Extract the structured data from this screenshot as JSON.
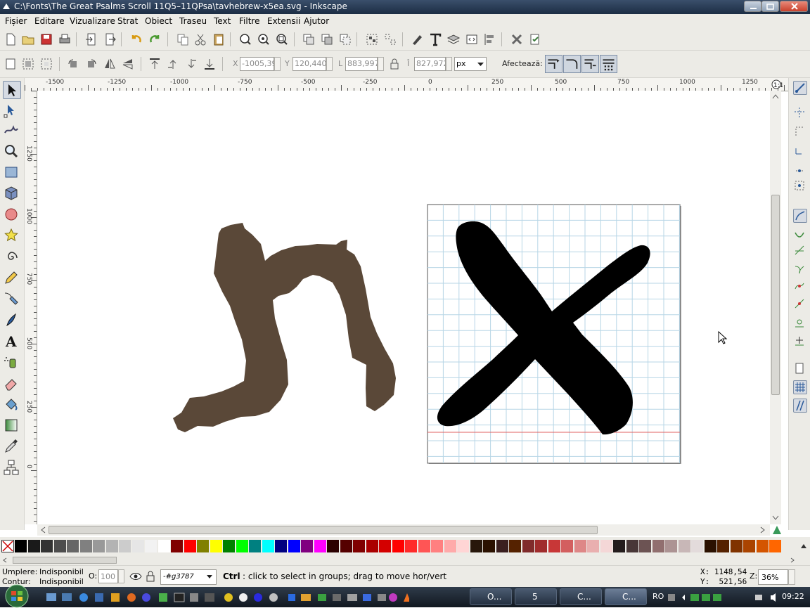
{
  "window": {
    "title": "C:\\Fonts\\The Great Psalms Scroll 11Q5–11QPsa\\tavhebrew-x5ea.svg - Inkscape"
  },
  "menu": [
    "Fișier",
    "Editare",
    "Vizualizare",
    "Strat",
    "Obiect",
    "Traseu",
    "Text",
    "Filtre",
    "Extensii",
    "Ajutor"
  ],
  "controls": {
    "x_label": "X",
    "x_value": "-1005,39",
    "y_label": "Y",
    "y_value": "120,440",
    "w_label": "L",
    "w_value": "883,997",
    "h_label": "Î",
    "h_value": "827,972",
    "unit": "px",
    "affect_label": "Afectează:"
  },
  "ruler": {
    "h_ticks": [
      "-1500",
      "-1250",
      "-1000",
      "-750",
      "-500",
      "-250",
      "0",
      "250",
      "500",
      "750",
      "1000",
      "1250"
    ],
    "v_ticks": [
      "1250",
      "1000",
      "750",
      "500",
      "250",
      "0"
    ]
  },
  "statusbar": {
    "fill_label": "Umplere:",
    "fill_value": "Indisponibil",
    "stroke_label": "Contur:",
    "stroke_value": "Indisponibil",
    "opacity_label": "O:",
    "opacity_value": "100",
    "layer_value": "-#g3787",
    "message_bold": "Ctrl",
    "message": ": click to select in groups; drag to move hor/vert",
    "cursor_x": "X: 1148,54",
    "cursor_y": "Y:  521,56",
    "zoom_label": "Z:",
    "zoom_value": "36%"
  },
  "taskbar": {
    "tasks": [
      "O...",
      "5",
      "C...",
      "C..."
    ],
    "lang": "RO",
    "clock": "09:22"
  },
  "colors": {
    "glyph_brown": "#5a4838",
    "grid_line": "#b7d6e6",
    "baseline": "#e06060",
    "accent": "#3a4f6b"
  },
  "palette": [
    "#000000",
    "#1a1a1a",
    "#333333",
    "#4d4d4d",
    "#666666",
    "#808080",
    "#999999",
    "#b3b3b3",
    "#cccccc",
    "#e6e6e6",
    "#f2f2f2",
    "#ffffff",
    "#800000",
    "#ff0000",
    "#808000",
    "#ffff00",
    "#008000",
    "#00ff00",
    "#008080",
    "#00ffff",
    "#000080",
    "#0000ff",
    "#800080",
    "#ff00ff",
    "#2b0000",
    "#550000",
    "#800000",
    "#aa0000",
    "#d40000",
    "#ff0000",
    "#ff2a2a",
    "#ff5555",
    "#ff8080",
    "#ffaaaa",
    "#ffd5d5",
    "#28170b",
    "#2b1100",
    "#3a1f1f",
    "#552200",
    "#802b2b",
    "#a02c2c",
    "#c83737",
    "#d35f5f",
    "#de8787",
    "#e9afaf",
    "#f4d7d7",
    "#241c1c",
    "#483737",
    "#6c5353",
    "#916f6f",
    "#ac9393",
    "#c8b7b7",
    "#e3dbdb",
    "#2b1100",
    "#552200",
    "#803300",
    "#aa4400",
    "#d45500",
    "#ff6600"
  ]
}
